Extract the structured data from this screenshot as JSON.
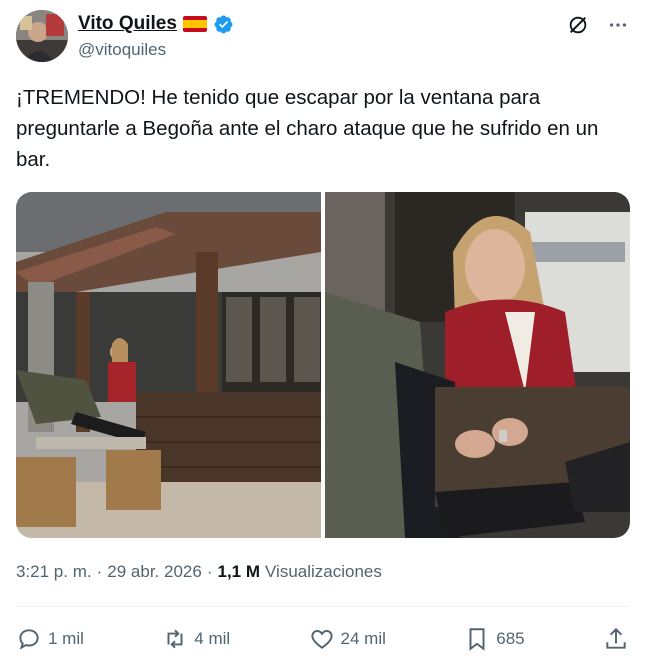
{
  "author": {
    "display_name": "Vito Quiles",
    "handle": "@vitoquiles",
    "flag_icon": "spain-flag-icon",
    "verified_color": "#1d9bf0"
  },
  "tweet": {
    "text": "¡TREMENDO! He tenido que escapar por la ventana para preguntarle a Begoña ante el charo ataque que he sufrido en un bar."
  },
  "meta": {
    "time": "3:21 p. m.",
    "separator": "·",
    "date": "29 abr. 2026",
    "views_count": "1,1 M",
    "views_label": "Visualizaciones"
  },
  "actions": {
    "replies": "1 mil",
    "reposts": "4 mil",
    "likes": "24 mil",
    "bookmarks": "685"
  },
  "colors": {
    "text": "#0f1419",
    "secondary": "#536471",
    "accent": "#1d9bf0"
  }
}
